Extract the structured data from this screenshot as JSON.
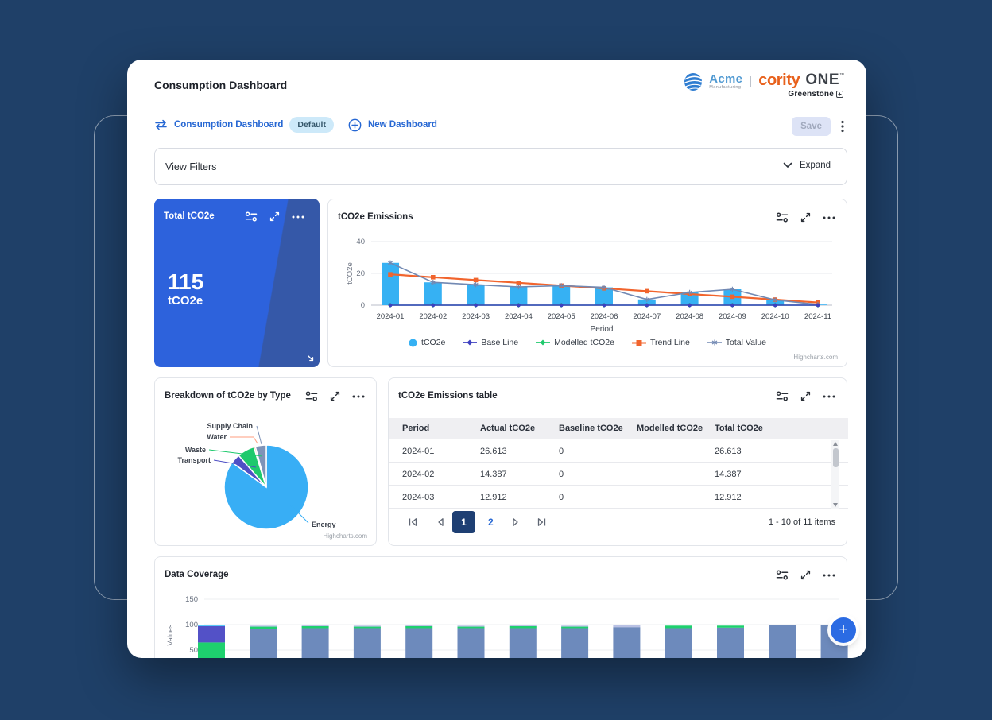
{
  "page": {
    "title": "Consumption Dashboard"
  },
  "brand": {
    "acme": "Acme",
    "acme_sub": "Manufacturing",
    "divider": "|",
    "cority": "cority",
    "one": "ONE",
    "tm": "™",
    "greenstone": "Greenstone"
  },
  "toolbar": {
    "dashboard_link": "Consumption Dashboard",
    "badge": "Default",
    "new_dashboard": "New Dashboard",
    "save": "Save"
  },
  "filters": {
    "label": "View Filters",
    "expand": "Expand"
  },
  "total_widget": {
    "title": "Total tCO2e",
    "value": "115",
    "unit": "tCO2e"
  },
  "emissions_widget": {
    "title": "tCO2e Emissions",
    "credit": "Highcharts.com"
  },
  "pie_widget": {
    "title": "Breakdown of tCO2e by Type",
    "credit": "Highcharts.com"
  },
  "table_widget": {
    "title": "tCO2e Emissions table",
    "columns": [
      "Period",
      "Actual tCO2e",
      "Baseline tCO2e",
      "Modelled tCO2e",
      "Total tCO2e"
    ],
    "rows": [
      [
        "2024-01",
        "26.613",
        "0",
        "",
        "26.613"
      ],
      [
        "2024-02",
        "14.387",
        "0",
        "",
        "14.387"
      ],
      [
        "2024-03",
        "12.912",
        "0",
        "",
        "12.912"
      ]
    ],
    "pagination": {
      "pages": [
        "1",
        "2"
      ],
      "current": "1",
      "info": "1 - 10 of 11 items"
    }
  },
  "coverage_widget": {
    "title": "Data Coverage"
  },
  "fab": {
    "label": "+"
  },
  "colors": {
    "accent_blue": "#2667d3",
    "navy_bg": "#1f4068",
    "card_blue": "#2d62dc",
    "card_blue_dark": "#3558a8",
    "fab_blue": "#2b6be3",
    "badge_bg": "#cde9f9",
    "active_page": "#1e3f73"
  },
  "chart_data": [
    {
      "id": "emissions",
      "type": "bar",
      "title": "tCO2e Emissions",
      "xlabel": "Period",
      "ylabel": "tCO2e",
      "yticks": [
        0,
        20,
        40
      ],
      "ylim": [
        0,
        44
      ],
      "grid": true,
      "legend_position": "bottom",
      "categories": [
        "2024-01",
        "2024-02",
        "2024-03",
        "2024-04",
        "2024-05",
        "2024-06",
        "2024-07",
        "2024-08",
        "2024-09",
        "2024-10",
        "2024-11"
      ],
      "series": [
        {
          "name": "tCO2e",
          "type": "column",
          "marker": "circle",
          "color": "#36b1f3",
          "values": [
            26.613,
            14.387,
            12.912,
            11.5,
            12.3,
            11.2,
            3.6,
            8,
            10,
            3.3,
            0.4
          ]
        },
        {
          "name": "Base Line",
          "type": "line",
          "marker": "circle",
          "color": "#3e40c0",
          "values": [
            0,
            0,
            0,
            0,
            0,
            0,
            0,
            0,
            0,
            0,
            0
          ]
        },
        {
          "name": "Modelled tCO2e",
          "type": "line",
          "marker": "diamond",
          "color": "#1fc96d",
          "values": [
            0,
            0,
            0,
            0,
            0,
            0,
            0,
            0,
            0,
            0,
            0
          ]
        },
        {
          "name": "Trend Line",
          "type": "line",
          "marker": "square",
          "color": "#f1642d",
          "values": [
            19.4,
            17.6,
            15.8,
            14.1,
            12.3,
            10.6,
            8.8,
            7,
            5.3,
            3.5,
            1.7
          ]
        },
        {
          "name": "Total Value",
          "type": "line",
          "marker": "star",
          "color": "#7289b3",
          "values": [
            26.613,
            14.387,
            12.912,
            11.5,
            12.3,
            11.2,
            3.6,
            8,
            10,
            3.3,
            0.4
          ]
        }
      ]
    },
    {
      "id": "pie",
      "type": "pie",
      "title": "Breakdown of tCO2e by Type",
      "slices": [
        {
          "label": "Energy",
          "pct": 85.0,
          "color": "#38aef5"
        },
        {
          "label": "Transport",
          "pct": 3.6,
          "color": "#4f50c5"
        },
        {
          "label": "Waste",
          "pct": 6.6,
          "color": "#1fc96d"
        },
        {
          "label": "Water",
          "pct": 0.6,
          "color": "#ff9e7f"
        },
        {
          "label": "Supply Chain",
          "pct": 4.2,
          "color": "#7e93b8"
        }
      ]
    },
    {
      "id": "coverage",
      "type": "stacked-bar",
      "title": "Data Coverage",
      "ylabel": "Values",
      "yticks": [
        50,
        100,
        150
      ],
      "colors": {
        "main": "#6d8abc",
        "green": "#1ed06e",
        "indigo": "#5351c7",
        "lightblue": "#4fc3f7",
        "lavender": "#b9c1e4"
      },
      "bars": [
        [
          [
            "green",
            65
          ],
          [
            "indigo",
            32
          ],
          [
            "lightblue",
            3
          ]
        ],
        [
          [
            "main",
            92
          ],
          [
            "green",
            4
          ],
          [
            "lavender",
            2
          ]
        ],
        [
          [
            "main",
            93
          ],
          [
            "green",
            4
          ],
          [
            "lavender",
            2
          ]
        ],
        [
          [
            "main",
            93
          ],
          [
            "green",
            3
          ],
          [
            "lavender",
            2
          ]
        ],
        [
          [
            "main",
            93
          ],
          [
            "green",
            4
          ],
          [
            "lavender",
            2
          ]
        ],
        [
          [
            "main",
            93
          ],
          [
            "green",
            3
          ],
          [
            "lavender",
            2
          ]
        ],
        [
          [
            "main",
            93
          ],
          [
            "green",
            4
          ],
          [
            "lavender",
            2
          ]
        ],
        [
          [
            "main",
            93
          ],
          [
            "green",
            3
          ],
          [
            "lavender",
            2
          ]
        ],
        [
          [
            "main",
            95
          ],
          [
            "lavender",
            4
          ]
        ],
        [
          [
            "main",
            93
          ],
          [
            "green",
            5
          ]
        ],
        [
          [
            "main",
            94
          ],
          [
            "green",
            4
          ]
        ],
        [
          [
            "main",
            99
          ]
        ],
        [
          [
            "main",
            99
          ]
        ]
      ]
    }
  ]
}
